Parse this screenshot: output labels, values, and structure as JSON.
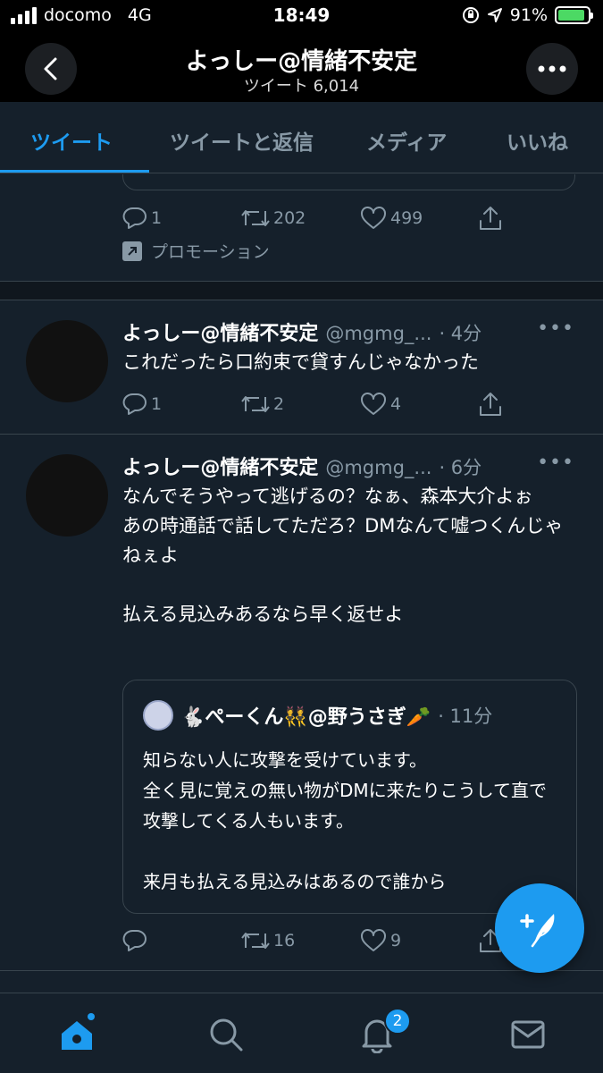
{
  "status_bar": {
    "carrier": "docomo",
    "network": "4G",
    "time": "18:49",
    "battery": "91%",
    "battery_level": 0.91
  },
  "header": {
    "title": "よっしー@情緒不安定",
    "subtitle": "ツイート 6,014"
  },
  "tabs": [
    {
      "label": "ツイート",
      "active": true
    },
    {
      "label": "ツイートと返信",
      "active": false
    },
    {
      "label": "メディア",
      "active": false
    },
    {
      "label": "いいね",
      "active": false
    }
  ],
  "promoted_tweet": {
    "replies": "1",
    "retweets": "202",
    "likes": "499",
    "promo_label": "プロモーション"
  },
  "tweets": [
    {
      "name": "よっしー@情緒不安定",
      "handle": "@mgmg_...",
      "time": "· 4分",
      "text": "これだったら口約束で貸すんじゃなかった",
      "replies": "1",
      "retweets": "2",
      "likes": "4"
    },
    {
      "name": "よっしー@情緒不安定",
      "handle": "@mgmg_...",
      "time": "· 6分",
      "text": "なんでそうやって逃げるの？なぁ、森本大介よぉ\nあの時通話で話してただろ？DMなんて嘘つくんじゃねぇよ\n\n払える見込みあるなら早く返せよ",
      "replies": "",
      "retweets": "16",
      "likes": "9",
      "quote": {
        "name": "🐇ぺーくん👯@野うさぎ🥕",
        "time": "· 11分",
        "text": "知らない人に攻撃を受けています。\n全く見に覚えの無い物がDMに来たりこうして直で攻撃してくる人もいます。\n\n来月も払える見込みはあるので誰から"
      }
    }
  ],
  "bottom_nav": {
    "notifications_badge": "2"
  },
  "colors": {
    "accent": "#1d9bf0",
    "background": "#15202b",
    "muted": "#8899a6"
  }
}
